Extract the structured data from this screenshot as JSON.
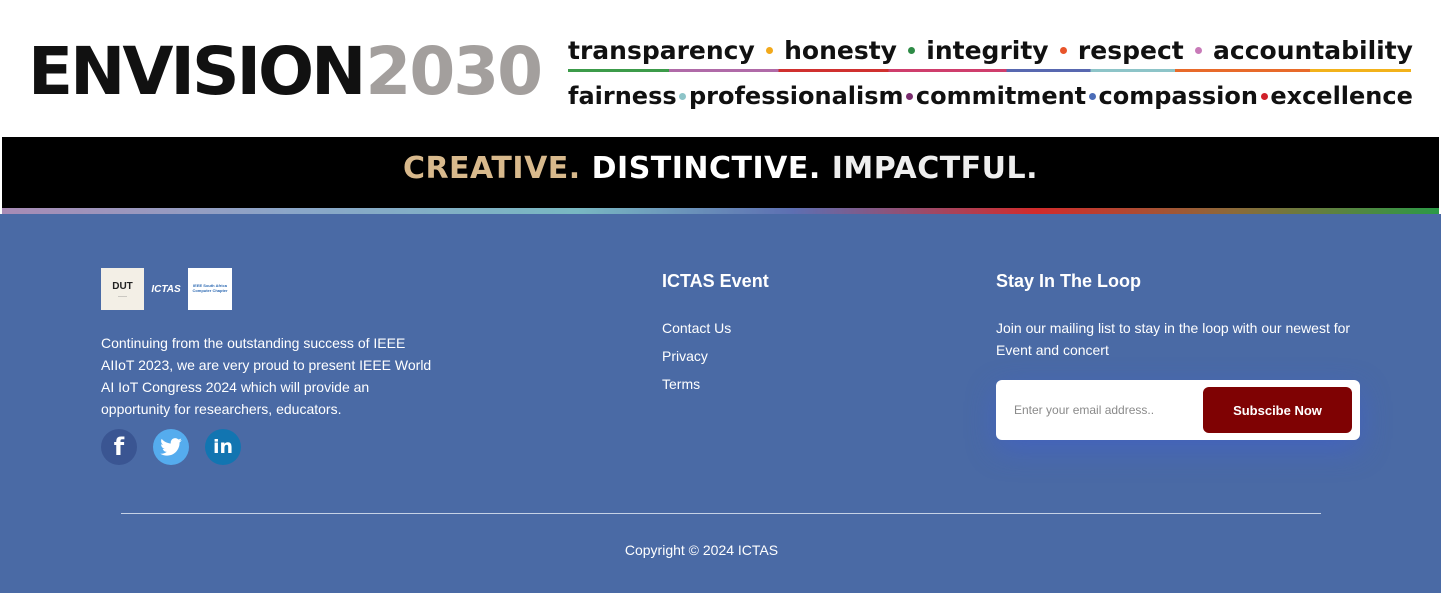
{
  "banner": {
    "logo_word": "ENVISION",
    "logo_year": "2030",
    "values_row1": [
      "transparency",
      "honesty",
      "integrity",
      "respect",
      "accountability"
    ],
    "values_row2": [
      "fairness",
      "professionalism",
      "commitment",
      "compassion",
      "excellence"
    ],
    "dot_colors_row1": [
      "#f2a91b",
      "#2e8b46",
      "#e8542a",
      "#c87ab8"
    ],
    "dot_colors_row2": [
      "#8dc4c8",
      "#7a2c6e",
      "#4b6cb7",
      "#d0202a"
    ],
    "tagline_1": "CREATIVE.",
    "tagline_2": "DISTINCTIVE.",
    "tagline_3": "IMPACTFUL."
  },
  "footer": {
    "partner_logos": {
      "dut": "DUT",
      "ictas": "ICTAS",
      "ieee": "IEEE South Africa Computer Chapter"
    },
    "about_text": "Continuing from the outstanding success of IEEE AIIoT 2023, we are very proud to present IEEE World AI IoT Congress 2024 which will provide an opportunity for researchers, educators.",
    "socials": [
      {
        "name": "facebook",
        "icon": "facebook-icon",
        "label": "f"
      },
      {
        "name": "twitter",
        "icon": "twitter-icon"
      },
      {
        "name": "linkedin",
        "icon": "linkedin-icon",
        "label": "in"
      }
    ],
    "event_title": "ICTAS Event",
    "event_links": [
      "Contact Us",
      "Privacy",
      "Terms"
    ],
    "loop_title": "Stay In The Loop",
    "loop_text": "Join our mailing list to stay in the loop with our newest for Event and concert",
    "email_placeholder": "Enter your email address..",
    "subscribe_label": "Subscibe Now",
    "copyright": "Copyright © 2024 ICTAS",
    "colors": {
      "footer_bg": "#4a6aa5",
      "button_bg": "#7f0203"
    }
  }
}
